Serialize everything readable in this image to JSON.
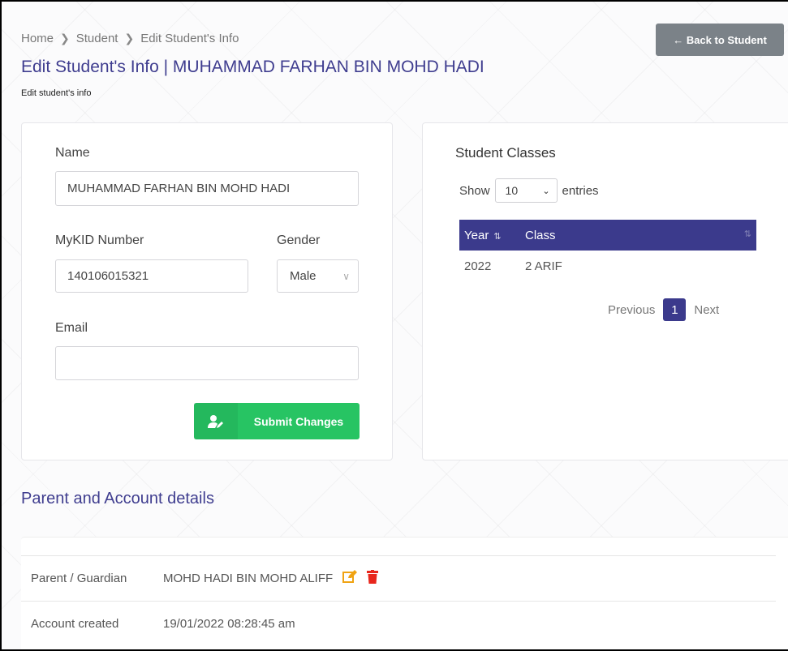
{
  "breadcrumb": [
    "Home",
    "Student",
    "Edit Student's Info"
  ],
  "back_button": "← Back to Student",
  "page": {
    "title": "Edit Student's Info | MUHAMMAD FARHAN BIN MOHD HADI",
    "subtitle": "Edit student's info"
  },
  "form": {
    "name_label": "Name",
    "name_value": "MUHAMMAD FARHAN BIN MOHD HADI",
    "mykid_label": "MyKID Number",
    "mykid_value": "140106015321",
    "gender_label": "Gender",
    "gender_value": "Male",
    "email_label": "Email",
    "email_value": "",
    "submit_label": "Submit Changes"
  },
  "classes": {
    "title": "Student Classes",
    "show_label": "Show",
    "entries_value": "10",
    "entries_label": "entries",
    "columns": [
      "Year",
      "Class"
    ],
    "rows": [
      {
        "year": "2022",
        "class": "2 ARIF"
      }
    ],
    "pager": {
      "previous": "Previous",
      "current": "1",
      "next": "Next"
    }
  },
  "parent_section": {
    "title": "Parent and Account details",
    "parent_label": "Parent / Guardian",
    "parent_value": "MOHD HADI BIN MOHD ALIFF",
    "created_label": "Account created",
    "created_value": "19/01/2022 08:28:45 am"
  },
  "colors": {
    "brand": "#3b3a8c",
    "success": "#27c463",
    "edit_icon": "#f0a313",
    "delete_icon": "#e8261c",
    "back_button": "#7b8288"
  },
  "icons": [
    "chevron-right-icon",
    "user-edit-icon",
    "edit-icon",
    "trash-icon",
    "sort-icon"
  ]
}
